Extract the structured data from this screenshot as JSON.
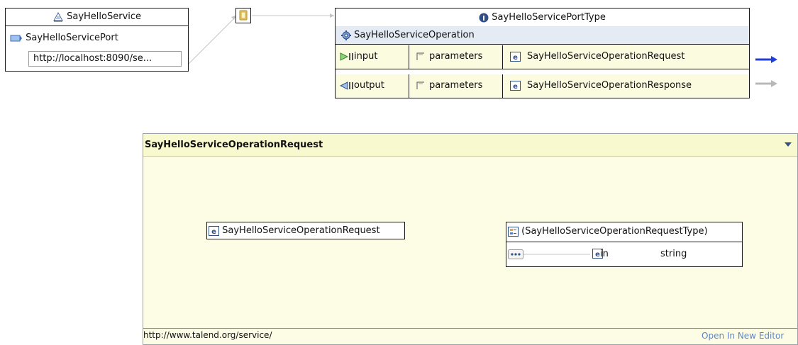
{
  "service": {
    "name": "SayHelloService",
    "port": "SayHelloServicePort",
    "address": "http://localhost:8090/se..."
  },
  "port_type": {
    "name": "SayHelloServicePortType",
    "operation": "SayHelloServiceOperation",
    "messages": [
      {
        "direction": "input",
        "part": "parameters",
        "element": "SayHelloServiceOperationRequest"
      },
      {
        "direction": "output",
        "part": "parameters",
        "element": "SayHelloServiceOperationResponse"
      }
    ]
  },
  "element_view": {
    "header": "SayHelloServiceOperationRequest",
    "request_element": "SayHelloServiceOperationRequest",
    "type_name": "(SayHelloServiceOperationRequestType)",
    "field_name": "in",
    "field_type": "string",
    "namespace": "http://www.talend.org/service/",
    "open_link": "Open In New Editor"
  },
  "icons": {
    "service": "service-icon",
    "port": "port-icon",
    "binding": "binding-icon",
    "interface": "interface-icon",
    "operation": "gear-icon",
    "input": "input-arrow-icon",
    "output": "output-arrow-icon",
    "part": "part-icon",
    "element": "element-icon",
    "complex_type": "complex-type-icon",
    "sequence": "sequence-icon",
    "dropdown": "dropdown-triangle-icon"
  },
  "colors": {
    "active_arrow": "#1f3fd8",
    "inactive_arrow": "#b8b8b8",
    "operation_header": "#e4ebf4",
    "message_row": "#fbfbe0",
    "element_panel": "#fdfde6",
    "link": "#5b86c5"
  }
}
